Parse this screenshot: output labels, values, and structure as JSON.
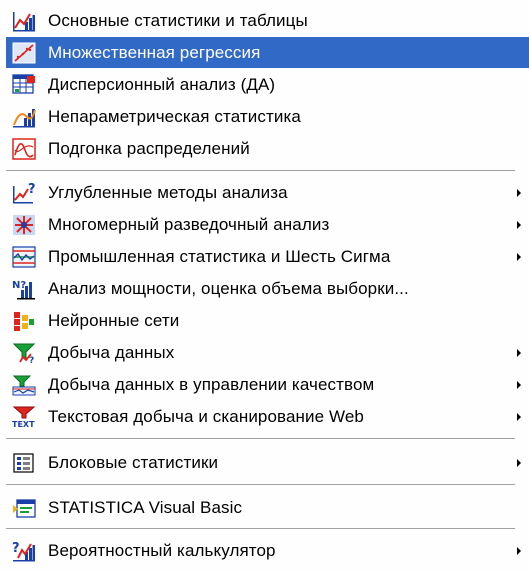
{
  "menu": {
    "items": [
      {
        "label": "Основные статистики и таблицы",
        "icon": "basic-stats-chart-icon",
        "submenu": false,
        "selected": false
      },
      {
        "label": "Множественная регрессия",
        "icon": "regression-line-icon",
        "submenu": false,
        "selected": true
      },
      {
        "label": "Дисперсионный анализ (ДА)",
        "icon": "anova-table-icon",
        "submenu": false,
        "selected": false
      },
      {
        "label": "Непараметрическая статистика",
        "icon": "nonparametric-chart-icon",
        "submenu": false,
        "selected": false
      },
      {
        "label": "Подгонка распределений",
        "icon": "distribution-fit-icon",
        "submenu": false,
        "selected": false
      },
      {
        "label": "Углубленные методы анализа",
        "icon": "advanced-methods-icon",
        "submenu": true,
        "selected": false
      },
      {
        "label": "Многомерный разведочный анализ",
        "icon": "multivariate-star-icon",
        "submenu": true,
        "selected": false
      },
      {
        "label": "Промышленная статистика и Шесть Сигма",
        "icon": "quality-control-icon",
        "submenu": true,
        "selected": false
      },
      {
        "label": "Анализ мощности, оценка объема выборки...",
        "icon": "power-analysis-icon",
        "submenu": false,
        "selected": false
      },
      {
        "label": "Нейронные сети",
        "icon": "neural-network-icon",
        "submenu": false,
        "selected": false
      },
      {
        "label": "Добыча данных",
        "icon": "data-mining-icon",
        "submenu": true,
        "selected": false
      },
      {
        "label": "Добыча данных в управлении качеством",
        "icon": "data-mining-quality-icon",
        "submenu": true,
        "selected": false
      },
      {
        "label": "Текстовая добыча и сканирование Web",
        "icon": "text-mining-icon",
        "submenu": true,
        "selected": false
      },
      {
        "label": "Блоковые статистики",
        "icon": "block-stats-icon",
        "submenu": true,
        "selected": false
      },
      {
        "label": "STATISTICA Visual Basic",
        "icon": "visual-basic-icon",
        "submenu": false,
        "selected": false
      },
      {
        "label": "Вероятностный калькулятор",
        "icon": "probability-calculator-icon",
        "submenu": true,
        "selected": false
      }
    ],
    "icon_text": {
      "text_mining": "TEXT",
      "power": "N?"
    },
    "colors": {
      "selection": "#3169c6",
      "menu_bg": "#fefefe",
      "separator": "#a0a0a0"
    }
  }
}
